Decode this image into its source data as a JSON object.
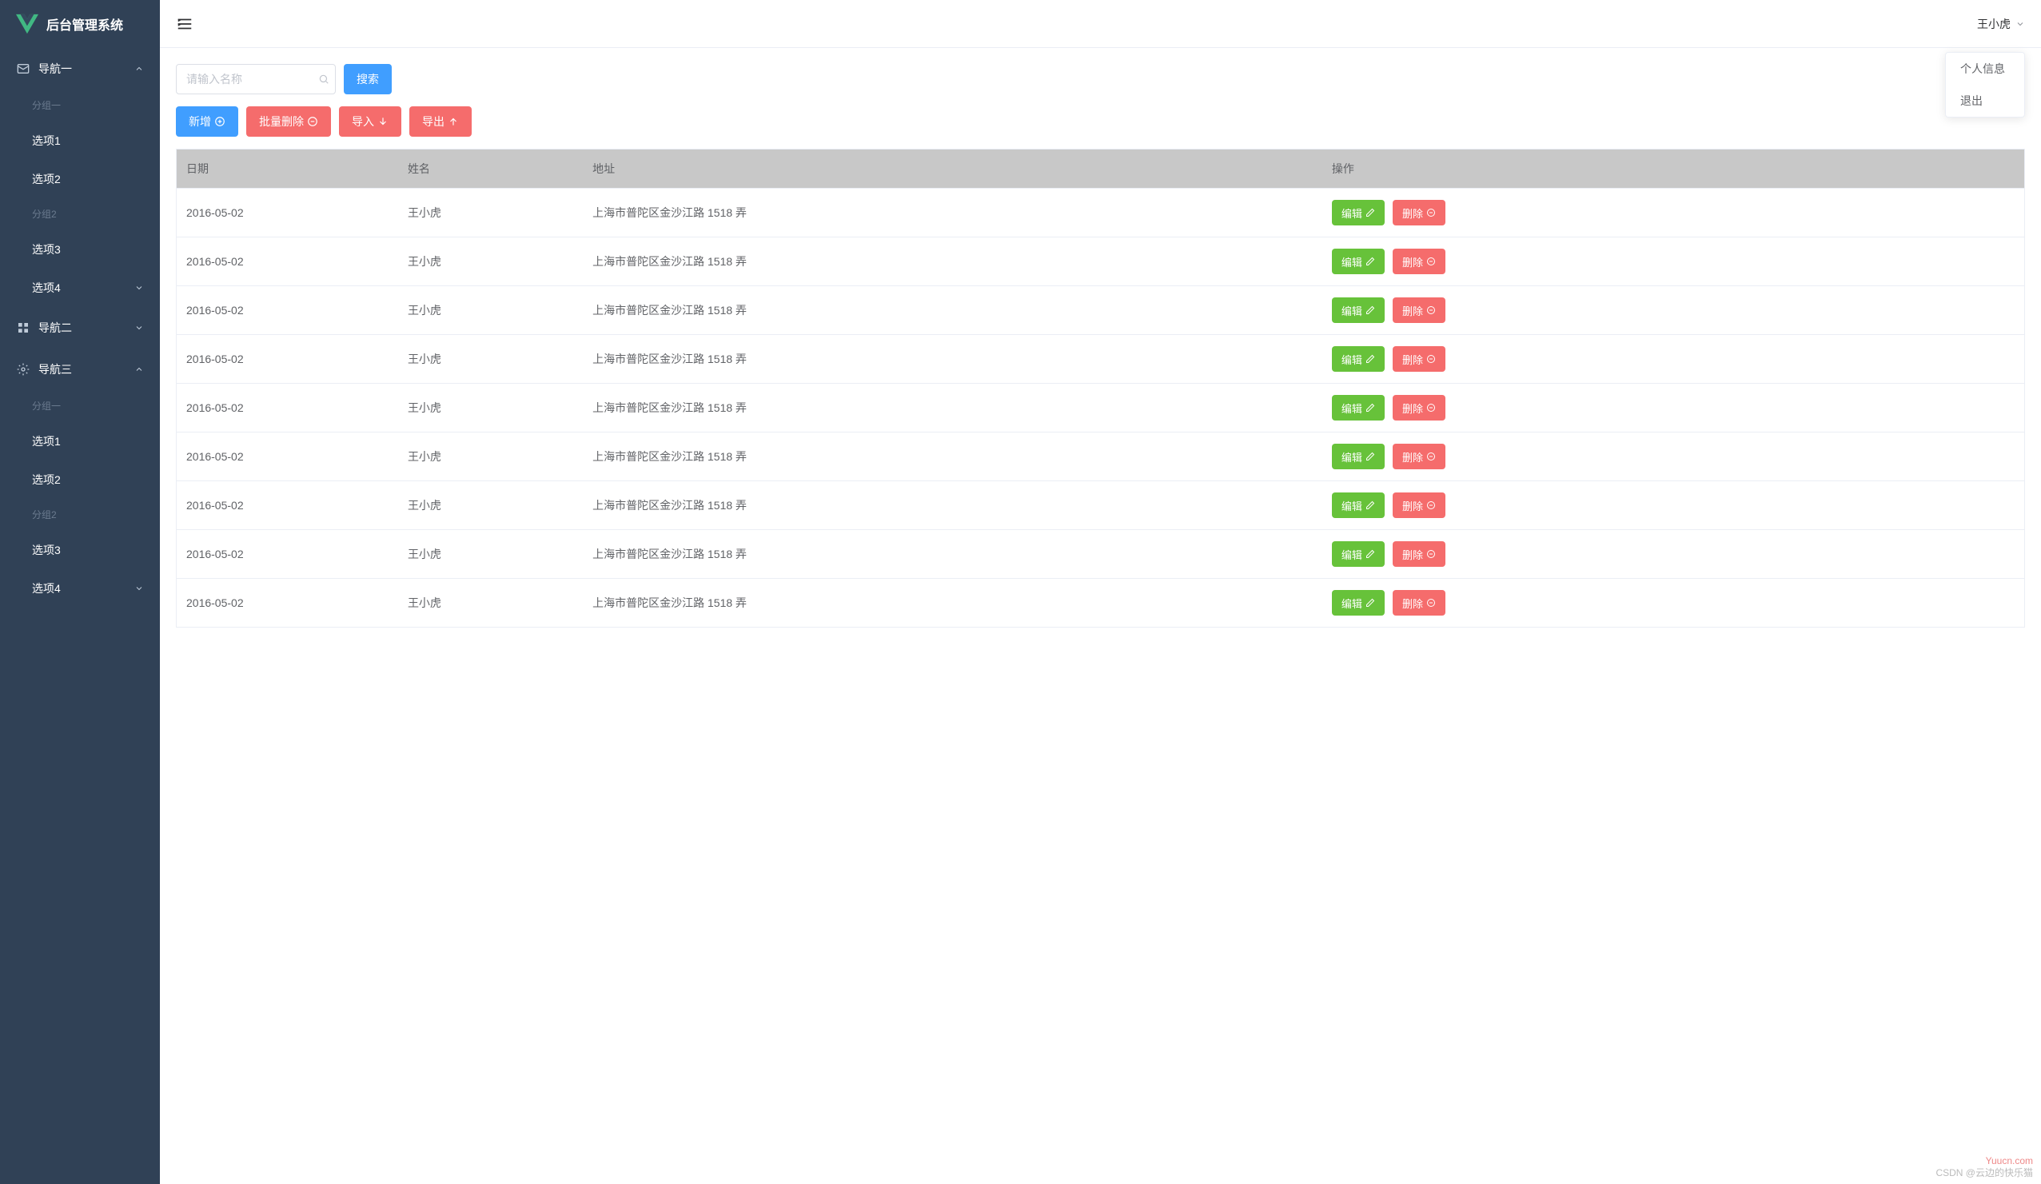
{
  "app_title": "后台管理系统",
  "header": {
    "username": "王小虎",
    "dropdown": {
      "profile": "个人信息",
      "logout": "退出"
    }
  },
  "search": {
    "placeholder": "请输入名称",
    "button": "搜索"
  },
  "toolbar": {
    "add": "新增",
    "batch_delete": "批量删除",
    "import": "导入",
    "export": "导出"
  },
  "sidebar": {
    "nav1": {
      "title": "导航一",
      "group1_title": "分组一",
      "item1": "选项1",
      "item2": "选项2",
      "group2_title": "分组2",
      "item3": "选项3",
      "item4": "选项4"
    },
    "nav2": {
      "title": "导航二"
    },
    "nav3": {
      "title": "导航三",
      "group1_title": "分组一",
      "item1": "选项1",
      "item2": "选项2",
      "group2_title": "分组2",
      "item3": "选项3",
      "item4": "选项4"
    }
  },
  "table": {
    "headers": {
      "date": "日期",
      "name": "姓名",
      "address": "地址",
      "action": "操作"
    },
    "actions": {
      "edit": "编辑",
      "delete": "删除"
    },
    "rows": [
      {
        "date": "2016-05-02",
        "name": "王小虎",
        "address": "上海市普陀区金沙江路 1518 弄"
      },
      {
        "date": "2016-05-02",
        "name": "王小虎",
        "address": "上海市普陀区金沙江路 1518 弄"
      },
      {
        "date": "2016-05-02",
        "name": "王小虎",
        "address": "上海市普陀区金沙江路 1518 弄"
      },
      {
        "date": "2016-05-02",
        "name": "王小虎",
        "address": "上海市普陀区金沙江路 1518 弄"
      },
      {
        "date": "2016-05-02",
        "name": "王小虎",
        "address": "上海市普陀区金沙江路 1518 弄"
      },
      {
        "date": "2016-05-02",
        "name": "王小虎",
        "address": "上海市普陀区金沙江路 1518 弄"
      },
      {
        "date": "2016-05-02",
        "name": "王小虎",
        "address": "上海市普陀区金沙江路 1518 弄"
      },
      {
        "date": "2016-05-02",
        "name": "王小虎",
        "address": "上海市普陀区金沙江路 1518 弄"
      },
      {
        "date": "2016-05-02",
        "name": "王小虎",
        "address": "上海市普陀区金沙江路 1518 弄"
      }
    ]
  },
  "watermark": {
    "top": "Yuucn.com",
    "bottom": "CSDN @云边的快乐猫"
  }
}
